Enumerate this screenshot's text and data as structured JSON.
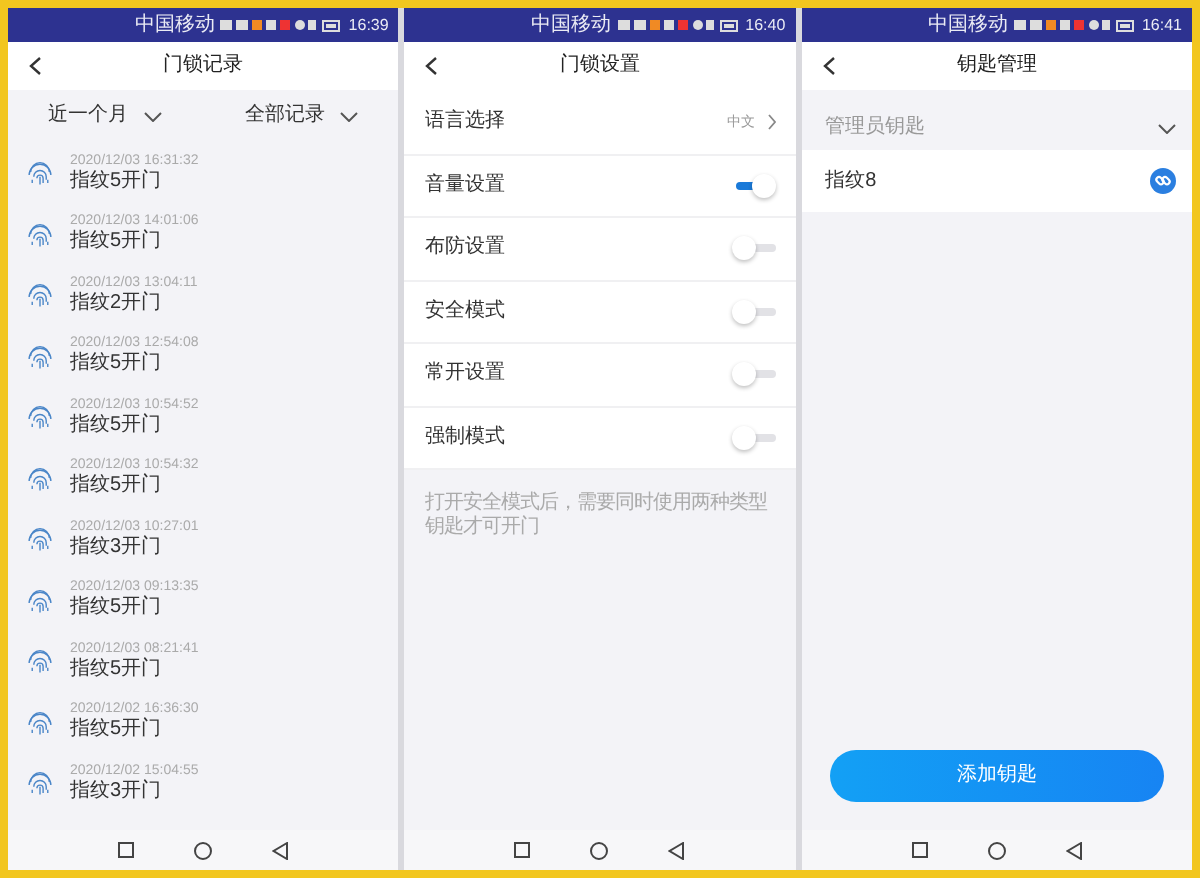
{
  "screens": [
    {
      "kind": "records",
      "status_bar": {
        "carrier": "中国移动",
        "time": "16:39"
      },
      "title": "门锁记录",
      "filters": [
        {
          "label": "近一个月"
        },
        {
          "label": "全部记录"
        }
      ],
      "records": [
        {
          "time": "2020/12/03 16:31:32",
          "text": "指纹5开门"
        },
        {
          "time": "2020/12/03 14:01:06",
          "text": "指纹5开门"
        },
        {
          "time": "2020/12/03 13:04:11",
          "text": "指纹2开门"
        },
        {
          "time": "2020/12/03 12:54:08",
          "text": "指纹5开门"
        },
        {
          "time": "2020/12/03 10:54:52",
          "text": "指纹5开门"
        },
        {
          "time": "2020/12/03 10:54:32",
          "text": "指纹5开门"
        },
        {
          "time": "2020/12/03 10:27:01",
          "text": "指纹3开门"
        },
        {
          "time": "2020/12/03 09:13:35",
          "text": "指纹5开门"
        },
        {
          "time": "2020/12/03 08:21:41",
          "text": "指纹5开门"
        },
        {
          "time": "2020/12/02 16:36:30",
          "text": "指纹5开门"
        },
        {
          "time": "2020/12/02 15:04:55",
          "text": "指纹3开门"
        }
      ]
    },
    {
      "kind": "settings",
      "status_bar": {
        "carrier": "中国移动",
        "time": "16:40"
      },
      "title": "门锁设置",
      "settings": [
        {
          "kind": "select",
          "label": "语言选择",
          "value": "中文"
        },
        {
          "kind": "toggle",
          "label": "音量设置",
          "on": true
        },
        {
          "kind": "toggle",
          "label": "布防设置",
          "on": false
        },
        {
          "kind": "toggle",
          "label": "安全模式",
          "on": false
        },
        {
          "kind": "toggle",
          "label": "常开设置",
          "on": false
        },
        {
          "kind": "toggle",
          "label": "强制模式",
          "on": false
        }
      ],
      "note": "打开安全模式后，需要同时使用两种类型钥匙才可开门"
    },
    {
      "kind": "keys",
      "status_bar": {
        "carrier": "中国移动",
        "time": "16:41"
      },
      "title": "钥匙管理",
      "section": "管理员钥匙",
      "keys": [
        {
          "label": "指纹8"
        }
      ],
      "button": "添加钥匙"
    }
  ]
}
